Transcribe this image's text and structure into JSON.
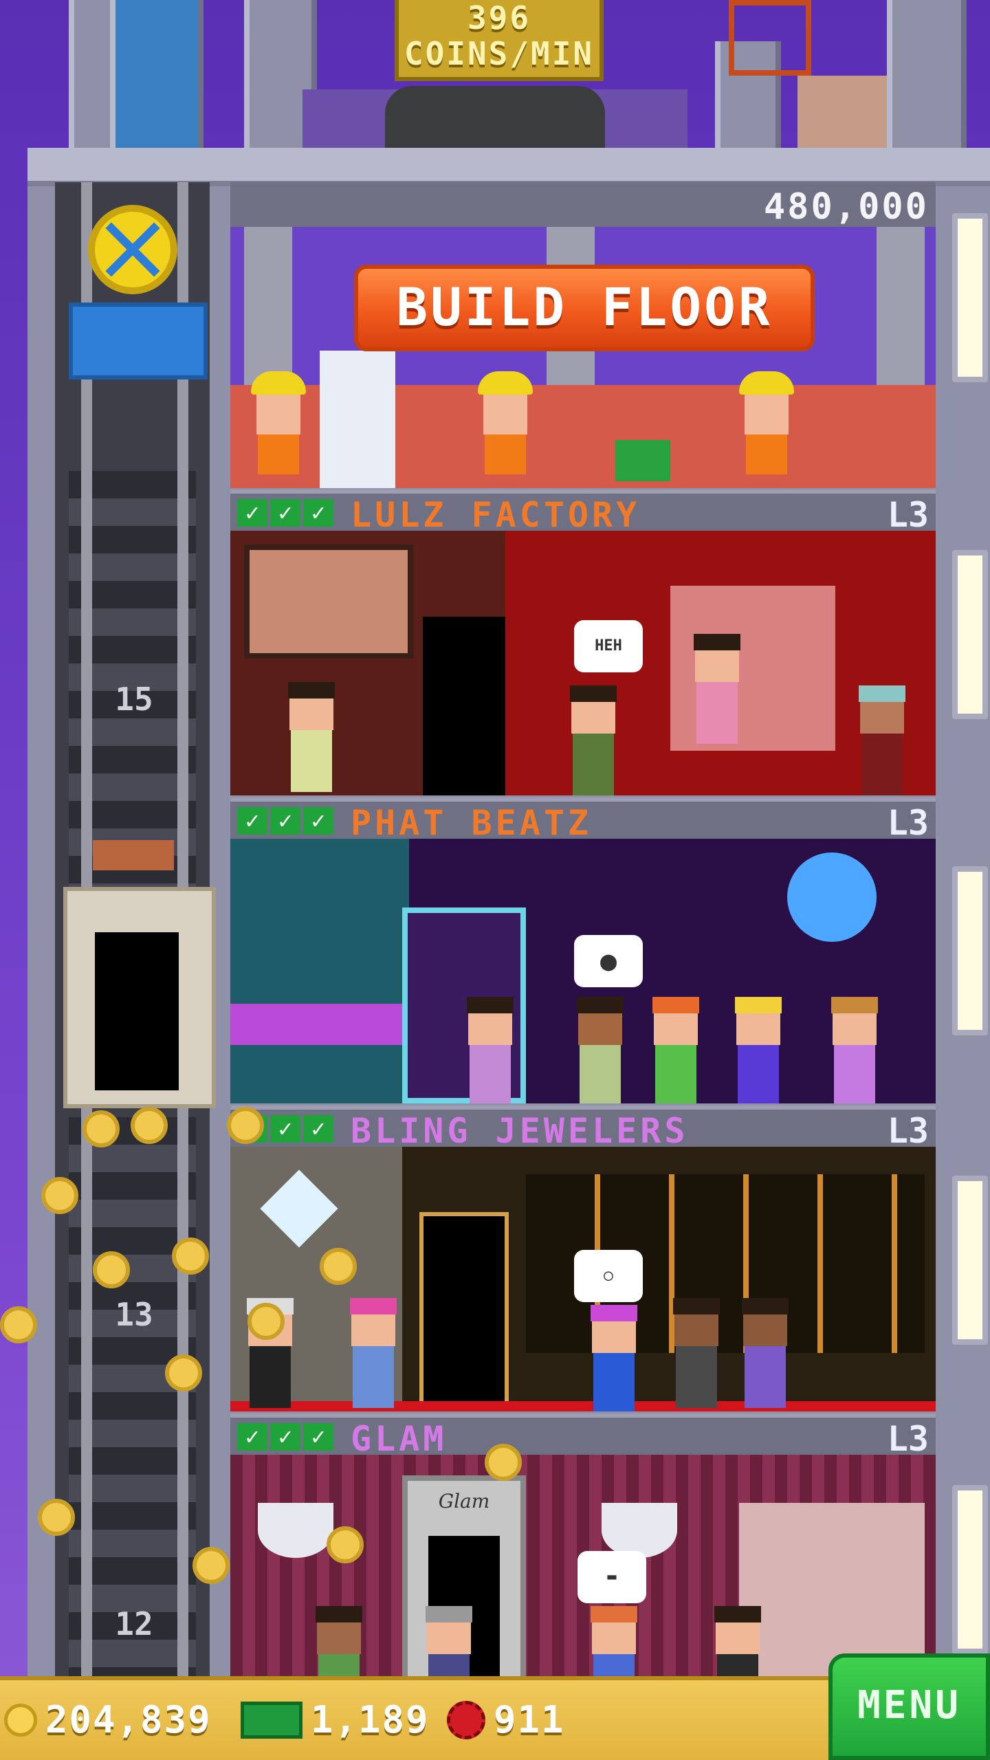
{
  "rooftop": {
    "coin_rate_value": "396",
    "coin_rate_unit": "COINS/MIN"
  },
  "build": {
    "cost": "480,000",
    "button_label": "BUILD FLOOR"
  },
  "elevator": {
    "floor_labels": [
      "15",
      "13",
      "12"
    ]
  },
  "floors": [
    {
      "name": "LULZ FACTORY",
      "level": "L3",
      "name_color": "#f07a2a",
      "bubble": "HEH"
    },
    {
      "name": "PHAT BEATZ",
      "level": "L3",
      "name_color": "#f07a2a"
    },
    {
      "name": "BLING JEWELERS",
      "level": "L3",
      "name_color": "#d47ae6"
    },
    {
      "name": "GLAM",
      "level": "L3",
      "name_color": "#d47ae6",
      "sign": "Glam"
    }
  ],
  "hud": {
    "coins": "204,839",
    "bux": "1,189",
    "gems": "911",
    "menu_label": "MENU"
  },
  "colors": {
    "accent": "#f15a1d",
    "menu_green": "#2db642",
    "hud_gold": "#e9bd48"
  }
}
